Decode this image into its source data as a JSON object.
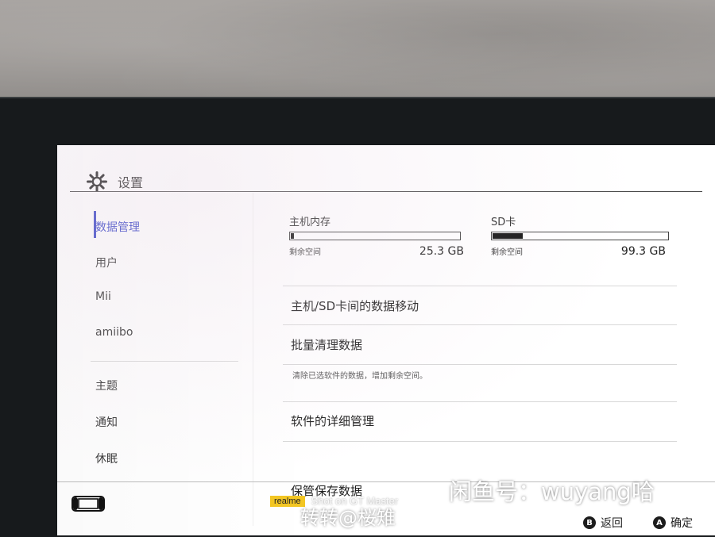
{
  "header": {
    "title": "设置",
    "icon": "gear-icon"
  },
  "sidebar": {
    "items": [
      {
        "label": "数据管理",
        "active": true
      },
      {
        "label": "用户"
      },
      {
        "label": "Mii"
      },
      {
        "label": "amiibo"
      },
      {
        "label": "主题"
      },
      {
        "label": "通知"
      },
      {
        "label": "休眠"
      }
    ]
  },
  "storage": {
    "system": {
      "label": "主机内存",
      "free_label": "剩余空间",
      "free_value": "25.3 GB",
      "used_fraction": 0.02
    },
    "sd": {
      "label": "SD卡",
      "free_label": "剩余空间",
      "free_value": "99.3 GB",
      "used_fraction": 0.17
    }
  },
  "options": [
    {
      "label": "主机/SD卡间的数据移动"
    },
    {
      "label": "批量清理数据",
      "description": "清除已选软件的数据，增加剩余空间。"
    },
    {
      "label": "软件的详细管理"
    },
    {
      "label": "保管保存数据"
    }
  ],
  "footer": {
    "back": {
      "button": "B",
      "label": "返回"
    },
    "confirm": {
      "button": "A",
      "label": "确定"
    }
  },
  "overlay": {
    "camera_brand": "realme",
    "camera_text": "Shot on GT Master",
    "watermark_1": "闲鱼号：wuyang哈",
    "watermark_2": "转转@桜雉"
  },
  "colors": {
    "accent": "#3a45c8",
    "screen_bg": "#ffffff",
    "bezel": "#171a1c"
  }
}
